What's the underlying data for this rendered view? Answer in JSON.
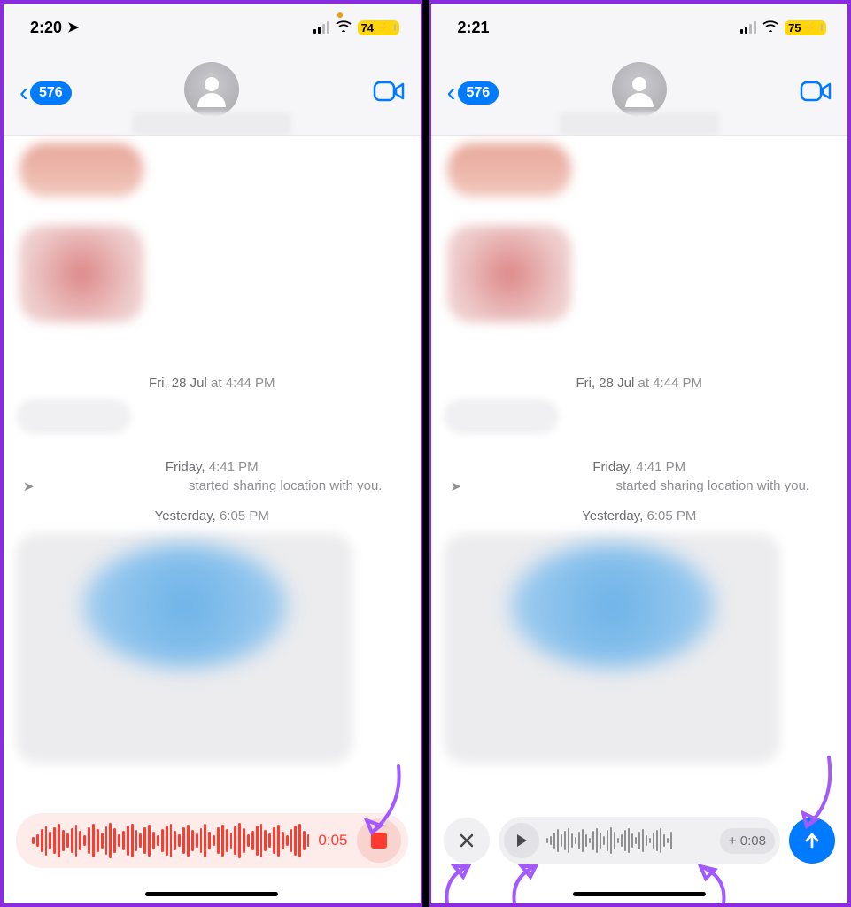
{
  "left": {
    "status": {
      "time": "2:20",
      "battery": "74",
      "bolt": "⚡︎"
    },
    "back_count": "576",
    "timestamps": {
      "t1_bold": "Fri, 28 Jul",
      "t1_at": "at",
      "t1_time": "4:44 PM",
      "t2_bold": "Friday,",
      "t2_time": "4:41 PM",
      "loc_text": "started sharing location with you.",
      "t3_bold": "Yesterday,",
      "t3_time": "6:05 PM"
    },
    "recording": {
      "time": "0:05"
    }
  },
  "right": {
    "status": {
      "time": "2:21",
      "battery": "75",
      "bolt": "⚡︎"
    },
    "back_count": "576",
    "timestamps": {
      "t1_bold": "Fri, 28 Jul",
      "t1_at": "at",
      "t1_time": "4:44 PM",
      "t2_bold": "Friday,",
      "t2_time": "4:41 PM",
      "loc_text": "started sharing location with you.",
      "t3_bold": "Yesterday,",
      "t3_time": "6:05 PM"
    },
    "preview": {
      "add_label": "+ 0:08"
    }
  }
}
